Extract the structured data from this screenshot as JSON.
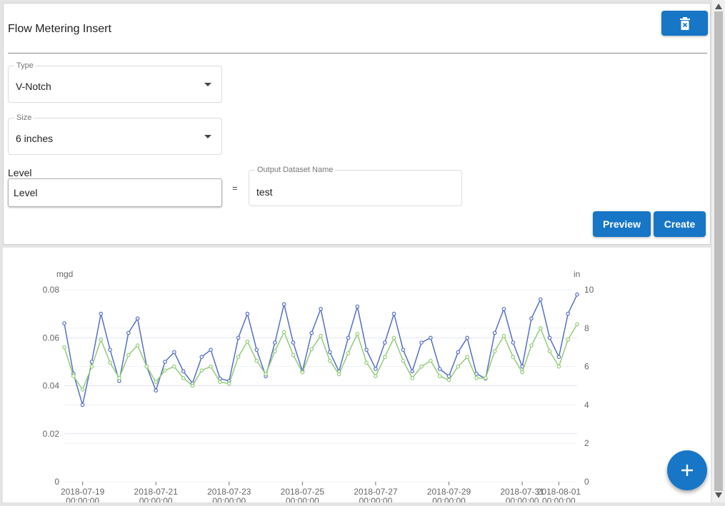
{
  "panel": {
    "title": "Flow Metering Insert",
    "type_field": {
      "label": "Type",
      "value": "V-Notch"
    },
    "size_field": {
      "label": "Size",
      "value": "6 inches"
    },
    "level": {
      "label": "Level",
      "value": "Level"
    },
    "equals": "=",
    "output": {
      "label": "Output Dataset Name",
      "value": "test"
    },
    "preview_label": "Preview",
    "create_label": "Create",
    "delete_icon": "trash-x-icon"
  },
  "fab_label": "+",
  "colors": {
    "accent": "#1776c6",
    "series_flow": "#5470c6",
    "series_level": "#91cc75"
  },
  "chart_data": {
    "type": "line",
    "left_axis": {
      "unit": "mgd",
      "ticks": [
        "0",
        "0.02",
        "0.04",
        "0.06",
        "0.08"
      ],
      "range": [
        0,
        0.08
      ]
    },
    "right_axis": {
      "unit": "in",
      "ticks": [
        "0",
        "2",
        "4",
        "6",
        "8",
        "10"
      ],
      "range": [
        0,
        10
      ]
    },
    "x_ticks": [
      {
        "date": "2018-07-19",
        "time": "00:00:00"
      },
      {
        "date": "2018-07-21",
        "time": "00:00:00"
      },
      {
        "date": "2018-07-23",
        "time": "00:00:00"
      },
      {
        "date": "2018-07-25",
        "time": "00:00:00"
      },
      {
        "date": "2018-07-27",
        "time": "00:00:00"
      },
      {
        "date": "2018-07-29",
        "time": "00:00:00"
      },
      {
        "date": "2018-07-31",
        "time": "00:00:00"
      },
      {
        "date": "2018-08-01",
        "time": "00:00:00"
      }
    ],
    "x_range": [
      "2018-07-18 12:00",
      "2018-08-01 12:00"
    ],
    "grid": true,
    "series": [
      {
        "axis": "left",
        "color": "#5470c6",
        "x": [
          "2018-07-18 12:00",
          "2018-07-18 18:00",
          "2018-07-19 00:00",
          "2018-07-19 06:00",
          "2018-07-19 12:00",
          "2018-07-19 18:00",
          "2018-07-20 00:00",
          "2018-07-20 06:00",
          "2018-07-20 12:00",
          "2018-07-20 18:00",
          "2018-07-21 00:00",
          "2018-07-21 06:00",
          "2018-07-21 12:00",
          "2018-07-21 18:00",
          "2018-07-22 00:00",
          "2018-07-22 06:00",
          "2018-07-22 12:00",
          "2018-07-22 18:00",
          "2018-07-23 00:00",
          "2018-07-23 06:00",
          "2018-07-23 12:00",
          "2018-07-23 18:00",
          "2018-07-24 00:00",
          "2018-07-24 06:00",
          "2018-07-24 12:00",
          "2018-07-24 18:00",
          "2018-07-25 00:00",
          "2018-07-25 06:00",
          "2018-07-25 12:00",
          "2018-07-25 18:00",
          "2018-07-26 00:00",
          "2018-07-26 06:00",
          "2018-07-26 12:00",
          "2018-07-26 18:00",
          "2018-07-27 00:00",
          "2018-07-27 06:00",
          "2018-07-27 12:00",
          "2018-07-27 18:00",
          "2018-07-28 00:00",
          "2018-07-28 06:00",
          "2018-07-28 12:00",
          "2018-07-28 18:00",
          "2018-07-29 00:00",
          "2018-07-29 06:00",
          "2018-07-29 12:00",
          "2018-07-29 18:00",
          "2018-07-30 00:00",
          "2018-07-30 06:00",
          "2018-07-30 12:00",
          "2018-07-30 18:00",
          "2018-07-31 00:00",
          "2018-07-31 06:00",
          "2018-07-31 12:00",
          "2018-07-31 18:00",
          "2018-08-01 00:00",
          "2018-08-01 06:00",
          "2018-08-01 12:00"
        ],
        "y": [
          0.066,
          0.045,
          0.032,
          0.05,
          0.07,
          0.055,
          0.042,
          0.062,
          0.068,
          0.048,
          0.038,
          0.05,
          0.054,
          0.046,
          0.041,
          0.052,
          0.055,
          0.043,
          0.042,
          0.06,
          0.07,
          0.055,
          0.044,
          0.058,
          0.074,
          0.058,
          0.046,
          0.062,
          0.072,
          0.054,
          0.046,
          0.06,
          0.073,
          0.055,
          0.047,
          0.058,
          0.07,
          0.055,
          0.046,
          0.058,
          0.06,
          0.047,
          0.044,
          0.054,
          0.06,
          0.045,
          0.043,
          0.062,
          0.072,
          0.058,
          0.048,
          0.068,
          0.076,
          0.06,
          0.052,
          0.07,
          0.078
        ]
      },
      {
        "axis": "right",
        "color": "#91cc75",
        "x": [
          "2018-07-18 12:00",
          "2018-07-18 18:00",
          "2018-07-19 00:00",
          "2018-07-19 06:00",
          "2018-07-19 12:00",
          "2018-07-19 18:00",
          "2018-07-20 00:00",
          "2018-07-20 06:00",
          "2018-07-20 12:00",
          "2018-07-20 18:00",
          "2018-07-21 00:00",
          "2018-07-21 06:00",
          "2018-07-21 12:00",
          "2018-07-21 18:00",
          "2018-07-22 00:00",
          "2018-07-22 06:00",
          "2018-07-22 12:00",
          "2018-07-22 18:00",
          "2018-07-23 00:00",
          "2018-07-23 06:00",
          "2018-07-23 12:00",
          "2018-07-23 18:00",
          "2018-07-24 00:00",
          "2018-07-24 06:00",
          "2018-07-24 12:00",
          "2018-07-24 18:00",
          "2018-07-25 00:00",
          "2018-07-25 06:00",
          "2018-07-25 12:00",
          "2018-07-25 18:00",
          "2018-07-26 00:00",
          "2018-07-26 06:00",
          "2018-07-26 12:00",
          "2018-07-26 18:00",
          "2018-07-27 00:00",
          "2018-07-27 06:00",
          "2018-07-27 12:00",
          "2018-07-27 18:00",
          "2018-07-28 00:00",
          "2018-07-28 06:00",
          "2018-07-28 12:00",
          "2018-07-28 18:00",
          "2018-07-29 00:00",
          "2018-07-29 06:00",
          "2018-07-29 12:00",
          "2018-07-29 18:00",
          "2018-07-30 00:00",
          "2018-07-30 06:00",
          "2018-07-30 12:00",
          "2018-07-30 18:00",
          "2018-07-31 00:00",
          "2018-07-31 06:00",
          "2018-07-31 12:00",
          "2018-07-31 18:00",
          "2018-08-01 00:00",
          "2018-08-01 06:00",
          "2018-08-01 12:00"
        ],
        "y": [
          7.0,
          5.5,
          4.8,
          6.0,
          7.4,
          6.2,
          5.4,
          6.6,
          7.1,
          6.0,
          5.2,
          5.8,
          6.0,
          5.4,
          5.0,
          5.8,
          6.0,
          5.2,
          5.1,
          6.5,
          7.3,
          6.3,
          5.6,
          6.8,
          7.8,
          6.6,
          5.7,
          6.9,
          7.6,
          6.3,
          5.6,
          6.7,
          7.7,
          6.2,
          5.5,
          6.5,
          7.5,
          6.3,
          5.4,
          6.0,
          6.3,
          5.5,
          5.3,
          6.0,
          6.5,
          5.4,
          5.4,
          6.8,
          7.6,
          6.5,
          5.7,
          7.1,
          8.0,
          6.8,
          6.0,
          7.4,
          8.2
        ]
      }
    ]
  }
}
